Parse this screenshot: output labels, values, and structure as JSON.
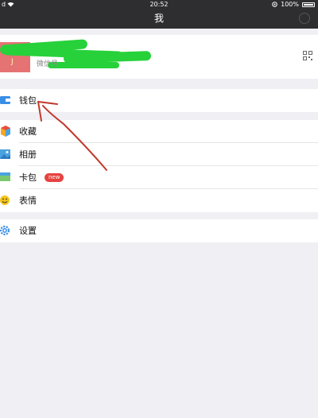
{
  "status": {
    "carrier": "d",
    "time": "20:52",
    "battery": "100%"
  },
  "nav": {
    "title": "我"
  },
  "profile": {
    "wechat_label": "微信号",
    "avatar_tag": "J"
  },
  "menu": {
    "wallet": "钱包",
    "favorites": "收藏",
    "album": "相册",
    "cards": "卡包",
    "cards_badge": "new",
    "stickers": "表情",
    "settings": "设置"
  },
  "colors": {
    "accent": "#1aad19",
    "badge": "#e64340",
    "annotation": "#c0392b"
  }
}
